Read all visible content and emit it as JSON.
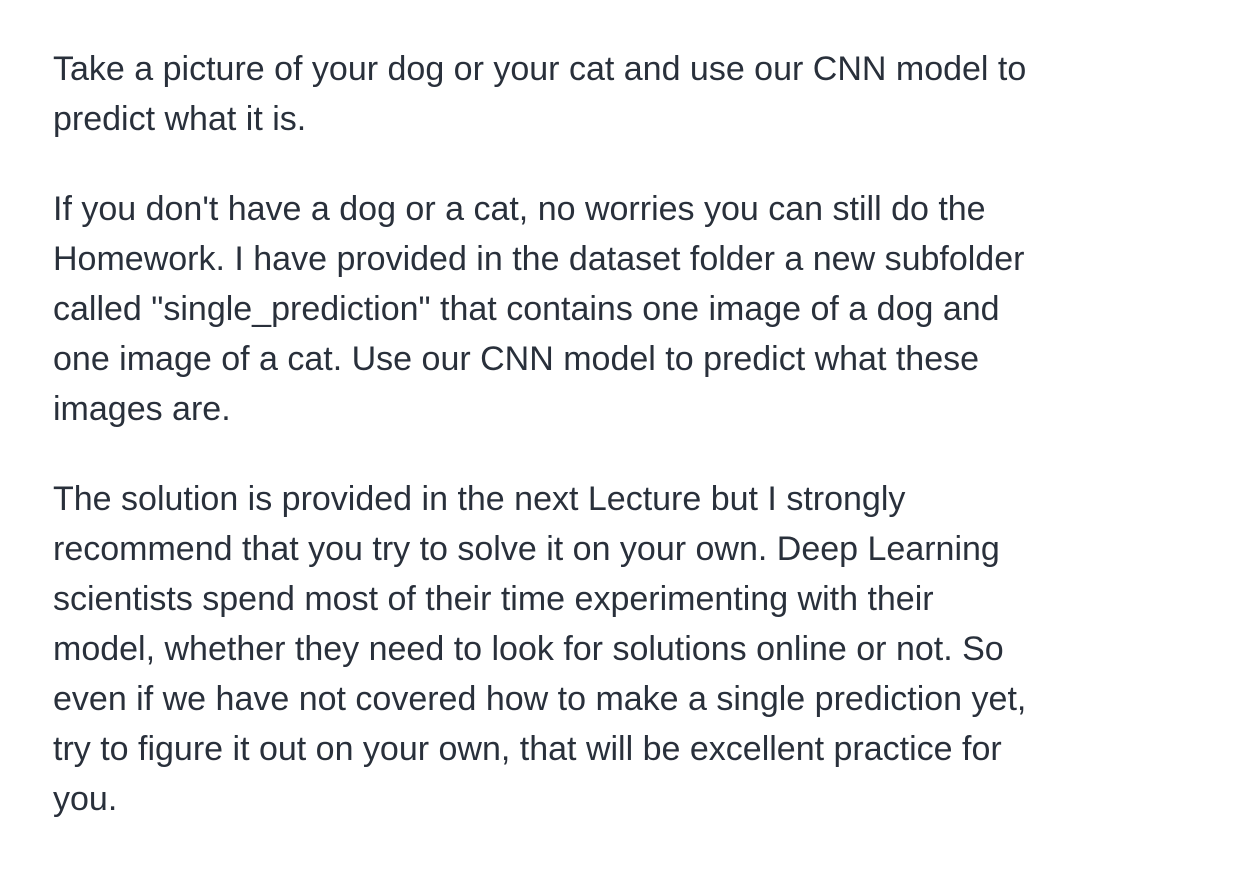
{
  "paragraphs": [
    {
      "lines": [
        "Take a picture of your dog or your cat and use our CNN model to",
        "predict what it is."
      ]
    },
    {
      "lines": [
        "If you don't have a dog or a cat, no worries you can still do the",
        "Homework. I have provided in the dataset folder a new subfolder",
        "called \"single_prediction\" that contains one image of a dog and",
        "one image of a cat. Use our CNN model to predict what these",
        "images are."
      ]
    },
    {
      "lines": [
        "The solution is provided in the next Lecture but I strongly",
        "recommend that you try to solve it on your own. Deep Learning",
        "scientists spend most of their time experimenting with their",
        "model, whether they need to look for solutions online or not. So",
        "even if we have not covered how to make a single prediction yet,",
        "try to figure it out on your own, that will be excellent practice for",
        "you."
      ]
    }
  ]
}
